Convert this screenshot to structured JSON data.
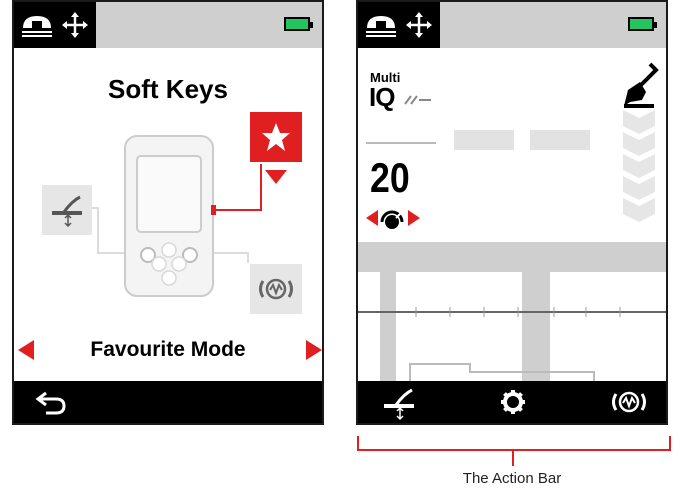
{
  "left_screen": {
    "title": "Soft Keys",
    "mode_label": "Favourite Mode"
  },
  "right_screen": {
    "multi_label": "Multi",
    "iq_label": "IQ",
    "sensitivity_value": "20"
  },
  "caption": "The Action Bar",
  "colors": {
    "accent_red": "#e02020",
    "battery_green": "#22c55e",
    "bar_grey": "#cfcfcf"
  },
  "icons": [
    "detect-mode-icon",
    "move-arrows-icon",
    "battery-icon",
    "star-icon",
    "back-icon",
    "detector-icon",
    "audio-mode-icon",
    "shovel-icon",
    "settings-icon",
    "knob-icon"
  ]
}
